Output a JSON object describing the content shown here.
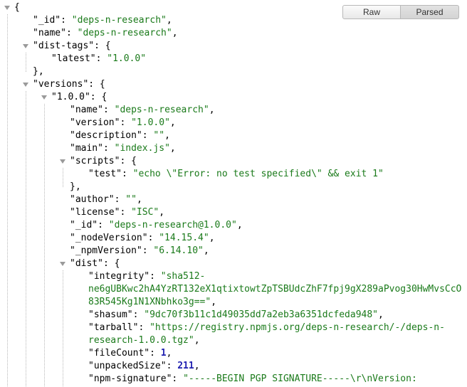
{
  "toolbar": {
    "raw_label": "Raw",
    "parsed_label": "Parsed",
    "active": "Parsed"
  },
  "json_lines": [
    {
      "indent": 0,
      "toggle": true,
      "parts": [
        [
          "p",
          "{"
        ]
      ]
    },
    {
      "indent": 1,
      "parts": [
        [
          "k",
          "\"_id\""
        ],
        [
          "p",
          ": "
        ],
        [
          "s",
          "\"deps-n-research\""
        ],
        [
          "p",
          ","
        ]
      ]
    },
    {
      "indent": 1,
      "parts": [
        [
          "k",
          "\"name\""
        ],
        [
          "p",
          ": "
        ],
        [
          "s",
          "\"deps-n-research\""
        ],
        [
          "p",
          ","
        ]
      ]
    },
    {
      "indent": 1,
      "toggle": true,
      "parts": [
        [
          "k",
          "\"dist-tags\""
        ],
        [
          "p",
          ": {"
        ]
      ]
    },
    {
      "indent": 2,
      "parts": [
        [
          "k",
          "\"latest\""
        ],
        [
          "p",
          ": "
        ],
        [
          "s",
          "\"1.0.0\""
        ]
      ]
    },
    {
      "indent": 1,
      "parts": [
        [
          "p",
          "},"
        ]
      ]
    },
    {
      "indent": 1,
      "toggle": true,
      "parts": [
        [
          "k",
          "\"versions\""
        ],
        [
          "p",
          ": {"
        ]
      ]
    },
    {
      "indent": 2,
      "toggle": true,
      "parts": [
        [
          "k",
          "\"1.0.0\""
        ],
        [
          "p",
          ": {"
        ]
      ]
    },
    {
      "indent": 3,
      "parts": [
        [
          "k",
          "\"name\""
        ],
        [
          "p",
          ": "
        ],
        [
          "s",
          "\"deps-n-research\""
        ],
        [
          "p",
          ","
        ]
      ]
    },
    {
      "indent": 3,
      "parts": [
        [
          "k",
          "\"version\""
        ],
        [
          "p",
          ": "
        ],
        [
          "s",
          "\"1.0.0\""
        ],
        [
          "p",
          ","
        ]
      ]
    },
    {
      "indent": 3,
      "parts": [
        [
          "k",
          "\"description\""
        ],
        [
          "p",
          ": "
        ],
        [
          "s",
          "\"\""
        ],
        [
          "p",
          ","
        ]
      ]
    },
    {
      "indent": 3,
      "parts": [
        [
          "k",
          "\"main\""
        ],
        [
          "p",
          ": "
        ],
        [
          "s",
          "\"index.js\""
        ],
        [
          "p",
          ","
        ]
      ]
    },
    {
      "indent": 3,
      "toggle": true,
      "parts": [
        [
          "k",
          "\"scripts\""
        ],
        [
          "p",
          ": {"
        ]
      ]
    },
    {
      "indent": 4,
      "parts": [
        [
          "k",
          "\"test\""
        ],
        [
          "p",
          ": "
        ],
        [
          "s",
          "\"echo \\\"Error: no test specified\\\" && exit 1\""
        ]
      ]
    },
    {
      "indent": 3,
      "parts": [
        [
          "p",
          "},"
        ]
      ]
    },
    {
      "indent": 3,
      "parts": [
        [
          "k",
          "\"author\""
        ],
        [
          "p",
          ": "
        ],
        [
          "s",
          "\"\""
        ],
        [
          "p",
          ","
        ]
      ]
    },
    {
      "indent": 3,
      "parts": [
        [
          "k",
          "\"license\""
        ],
        [
          "p",
          ": "
        ],
        [
          "s",
          "\"ISC\""
        ],
        [
          "p",
          ","
        ]
      ]
    },
    {
      "indent": 3,
      "parts": [
        [
          "k",
          "\"_id\""
        ],
        [
          "p",
          ": "
        ],
        [
          "s",
          "\"deps-n-research@1.0.0\""
        ],
        [
          "p",
          ","
        ]
      ]
    },
    {
      "indent": 3,
      "parts": [
        [
          "k",
          "\"_nodeVersion\""
        ],
        [
          "p",
          ": "
        ],
        [
          "s",
          "\"14.15.4\""
        ],
        [
          "p",
          ","
        ]
      ]
    },
    {
      "indent": 3,
      "parts": [
        [
          "k",
          "\"_npmVersion\""
        ],
        [
          "p",
          ": "
        ],
        [
          "s",
          "\"6.14.10\""
        ],
        [
          "p",
          ","
        ]
      ]
    },
    {
      "indent": 3,
      "toggle": true,
      "parts": [
        [
          "k",
          "\"dist\""
        ],
        [
          "p",
          ": {"
        ]
      ]
    },
    {
      "indent": 4,
      "parts": [
        [
          "k",
          "\"integrity\""
        ],
        [
          "p",
          ": "
        ],
        [
          "s",
          "\"sha512-"
        ]
      ]
    },
    {
      "indent": 4,
      "parts": [
        [
          "s",
          "ne6gUBKwc2hA4YzRT132eX1qtixtowtZpTSBUdcZhF7fpj9gX289aPvog30HwMvsCcO"
        ]
      ]
    },
    {
      "indent": 4,
      "parts": [
        [
          "s",
          "83R545Kg1N1XNbhko3g==\""
        ],
        [
          "p",
          ","
        ]
      ]
    },
    {
      "indent": 4,
      "parts": [
        [
          "k",
          "\"shasum\""
        ],
        [
          "p",
          ": "
        ],
        [
          "s",
          "\"9dc70f3b11c1d49035dd7a2eb3a6351dcfeda948\""
        ],
        [
          "p",
          ","
        ]
      ]
    },
    {
      "indent": 4,
      "parts": [
        [
          "k",
          "\"tarball\""
        ],
        [
          "p",
          ": "
        ],
        [
          "s",
          "\"https://registry.npmjs.org/deps-n-research/-/deps-n-"
        ]
      ]
    },
    {
      "indent": 4,
      "parts": [
        [
          "s",
          "research-1.0.0.tgz\""
        ],
        [
          "p",
          ","
        ]
      ]
    },
    {
      "indent": 4,
      "parts": [
        [
          "k",
          "\"fileCount\""
        ],
        [
          "p",
          ": "
        ],
        [
          "n",
          "1"
        ],
        [
          "p",
          ","
        ]
      ]
    },
    {
      "indent": 4,
      "parts": [
        [
          "k",
          "\"unpackedSize\""
        ],
        [
          "p",
          ": "
        ],
        [
          "n",
          "211"
        ],
        [
          "p",
          ","
        ]
      ]
    },
    {
      "indent": 4,
      "parts": [
        [
          "k",
          "\"npm-signature\""
        ],
        [
          "p",
          ": "
        ],
        [
          "s",
          "\"-----BEGIN PGP SIGNATURE-----\\r\\nVersion:"
        ]
      ]
    }
  ]
}
